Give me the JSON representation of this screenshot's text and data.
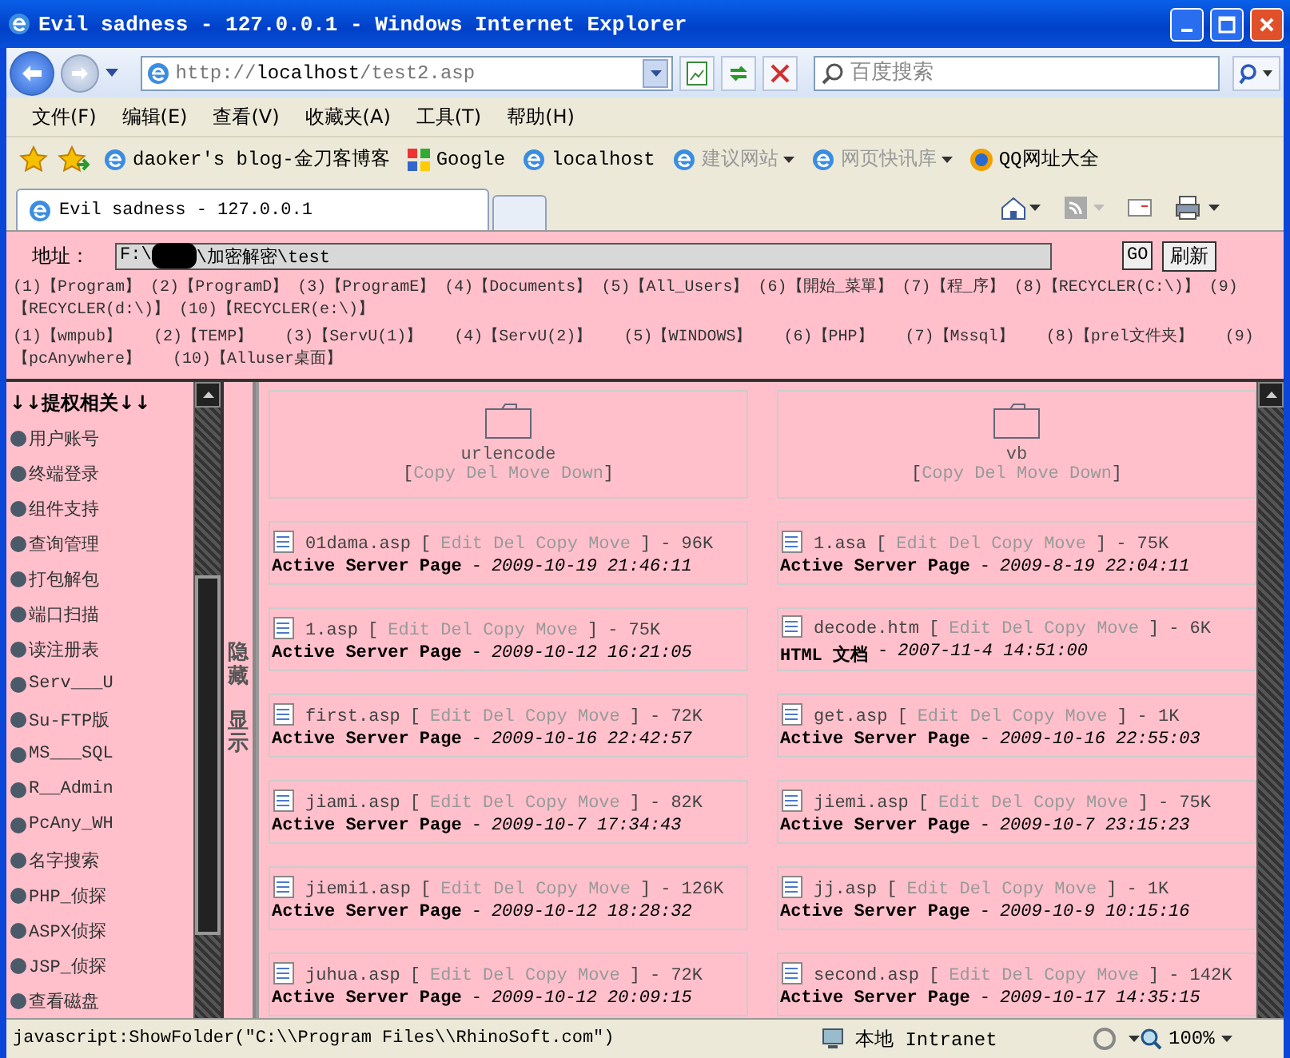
{
  "window": {
    "title": "Evil sadness - 127.0.0.1 - Windows Internet Explorer"
  },
  "navigation": {
    "url_host": "http://",
    "url_bold": "localhost",
    "url_path": "/test2.asp",
    "search_placeholder": "百度搜索"
  },
  "menu": [
    "文件(F)",
    "编辑(E)",
    "查看(V)",
    "收藏夹(A)",
    "工具(T)",
    "帮助(H)"
  ],
  "favorites": [
    {
      "label": "daoker's blog-金刀客博客",
      "kind": "page",
      "disabled": false,
      "has_menu": false
    },
    {
      "label": "Google",
      "kind": "google",
      "disabled": false,
      "has_menu": false
    },
    {
      "label": "localhost",
      "kind": "page",
      "disabled": false,
      "has_menu": false
    },
    {
      "label": "建议网站",
      "kind": "page",
      "disabled": true,
      "has_menu": true
    },
    {
      "label": "网页快讯库",
      "kind": "page",
      "disabled": true,
      "has_menu": true
    },
    {
      "label": "QQ网址大全",
      "kind": "globe",
      "disabled": false,
      "has_menu": false
    }
  ],
  "tabs": [
    {
      "label": "Evil sadness - 127.0.0.1",
      "selected": true
    }
  ],
  "page": {
    "address_label": "地址：",
    "path_start": "F:\\",
    "path_end": "\\加密解密\\test",
    "go": "GO",
    "refresh": "刷新",
    "link_groups": [
      [
        {
          "num": "(1)",
          "label": "【Program】"
        },
        {
          "num": "(2)",
          "label": "【ProgramD】"
        },
        {
          "num": "(3)",
          "label": "【ProgramE】"
        },
        {
          "num": "(4)",
          "label": "【Documents】"
        },
        {
          "num": "(5)",
          "label": "【All_Users】"
        },
        {
          "num": "(6)",
          "label": "【開始_菜單】"
        },
        {
          "num": "(7)",
          "label": "【程_序】"
        },
        {
          "num": "(8)",
          "label": "【RECYCLER(C:\\)】"
        },
        {
          "num": "(9)",
          "label": "【RECYCLER(d:\\)】"
        },
        {
          "num": "(10)",
          "label": "【RECYCLER(e:\\)】"
        }
      ],
      [
        {
          "num": "(1)",
          "label": "【wmpub】"
        },
        {
          "num": "(2)",
          "label": "【TEMP】"
        },
        {
          "num": "(3)",
          "label": "【ServU(1)】"
        },
        {
          "num": "(4)",
          "label": "【ServU(2)】"
        },
        {
          "num": "(5)",
          "label": "【WINDOWS】"
        },
        {
          "num": "(6)",
          "label": "【PHP】"
        },
        {
          "num": "(7)",
          "label": "【Mssql】"
        },
        {
          "num": "(8)",
          "label": "【prel文件夹】"
        },
        {
          "num": "(9)",
          "label": "【pcAnywhere】"
        },
        {
          "num": "(10)",
          "label": "【Alluser桌面】"
        }
      ]
    ],
    "sidebar": {
      "heading": "↓↓提权相关↓↓",
      "items": [
        "用户账号",
        "终端登录",
        "组件支持",
        "查询管理",
        "打包解包",
        "端口扫描",
        "读注册表",
        "Serv___U",
        "Su-FTP版",
        "MS___SQL",
        "R__Admin",
        "PcAny_WH",
        "名字搜索",
        "PHP_侦探",
        "ASPX侦探",
        "JSP_侦探",
        "查看磁盘"
      ]
    },
    "toggle": [
      "隐藏",
      "显示"
    ],
    "folders": [
      {
        "name": "urlencode",
        "lbracket": "[",
        "actions": [
          "Copy",
          "Del",
          "Move",
          "Down"
        ],
        "rbracket": "]"
      },
      {
        "name": "vb",
        "lbracket": "[",
        "actions": [
          "Copy",
          "Del",
          "Move",
          "Down"
        ],
        "rbracket": "]"
      }
    ],
    "files": [
      {
        "name": "01dama.asp",
        "lbracket": "[",
        "actions": [
          "Edit",
          "Del",
          "Copy",
          "Move"
        ],
        "rbracket": "]",
        "size": "- 96K",
        "type": "Active Server Page",
        "dash": "-",
        "date": "2009-10-19 21:46:11"
      },
      {
        "name": "1.asa",
        "lbracket": "[",
        "actions": [
          "Edit",
          "Del",
          "Copy",
          "Move"
        ],
        "rbracket": "]",
        "size": "- 75K",
        "type": "Active Server Page",
        "dash": "-",
        "date": "2009-8-19 22:04:11"
      },
      {
        "name": "1.asp",
        "lbracket": "[",
        "actions": [
          "Edit",
          "Del",
          "Copy",
          "Move"
        ],
        "rbracket": "]",
        "size": "- 75K",
        "type": "Active Server Page",
        "dash": "-",
        "date": "2009-10-12 16:21:05"
      },
      {
        "name": "decode.htm",
        "lbracket": "[",
        "actions": [
          "Edit",
          "Del",
          "Copy",
          "Move"
        ],
        "rbracket": "]",
        "size": "- 6K",
        "type": "HTML 文档",
        "dash": "-",
        "date": "2007-11-4 14:51:00"
      },
      {
        "name": "first.asp",
        "lbracket": "[",
        "actions": [
          "Edit",
          "Del",
          "Copy",
          "Move"
        ],
        "rbracket": "]",
        "size": "- 72K",
        "type": "Active Server Page",
        "dash": "-",
        "date": "2009-10-16 22:42:57"
      },
      {
        "name": "get.asp",
        "lbracket": "[",
        "actions": [
          "Edit",
          "Del",
          "Copy",
          "Move"
        ],
        "rbracket": "]",
        "size": "- 1K",
        "type": "Active Server Page",
        "dash": "-",
        "date": "2009-10-16 22:55:03"
      },
      {
        "name": "jiami.asp",
        "lbracket": "[",
        "actions": [
          "Edit",
          "Del",
          "Copy",
          "Move"
        ],
        "rbracket": "]",
        "size": "- 82K",
        "type": "Active Server Page",
        "dash": "-",
        "date": "2009-10-7 17:34:43"
      },
      {
        "name": "jiemi.asp",
        "lbracket": "[",
        "actions": [
          "Edit",
          "Del",
          "Copy",
          "Move"
        ],
        "rbracket": "]",
        "size": "- 75K",
        "type": "Active Server Page",
        "dash": "-",
        "date": "2009-10-7 23:15:23"
      },
      {
        "name": "jiemi1.asp",
        "lbracket": "[",
        "actions": [
          "Edit",
          "Del",
          "Copy",
          "Move"
        ],
        "rbracket": "]",
        "size": "- 126K",
        "type": "Active Server Page",
        "dash": "-",
        "date": "2009-10-12 18:28:32"
      },
      {
        "name": "jj.asp",
        "lbracket": "[",
        "actions": [
          "Edit",
          "Del",
          "Copy",
          "Move"
        ],
        "rbracket": "]",
        "size": "- 1K",
        "type": "Active Server Page",
        "dash": "-",
        "date": "2009-10-9 10:15:16"
      },
      {
        "name": "juhua.asp",
        "lbracket": "[",
        "actions": [
          "Edit",
          "Del",
          "Copy",
          "Move"
        ],
        "rbracket": "]",
        "size": "- 72K",
        "type": "Active Server Page",
        "dash": "-",
        "date": "2009-10-12 20:09:15"
      },
      {
        "name": "second.asp",
        "lbracket": "[",
        "actions": [
          "Edit",
          "Del",
          "Copy",
          "Move"
        ],
        "rbracket": "]",
        "size": "- 142K",
        "type": "Active Server Page",
        "dash": "-",
        "date": "2009-10-17 14:35:15"
      }
    ]
  },
  "status_bar": {
    "text": "javascript:ShowFolder(\"C:\\\\Program Files\\\\RhinoSoft.com\")",
    "zone": "本地 Intranet",
    "zoom": "100%"
  }
}
